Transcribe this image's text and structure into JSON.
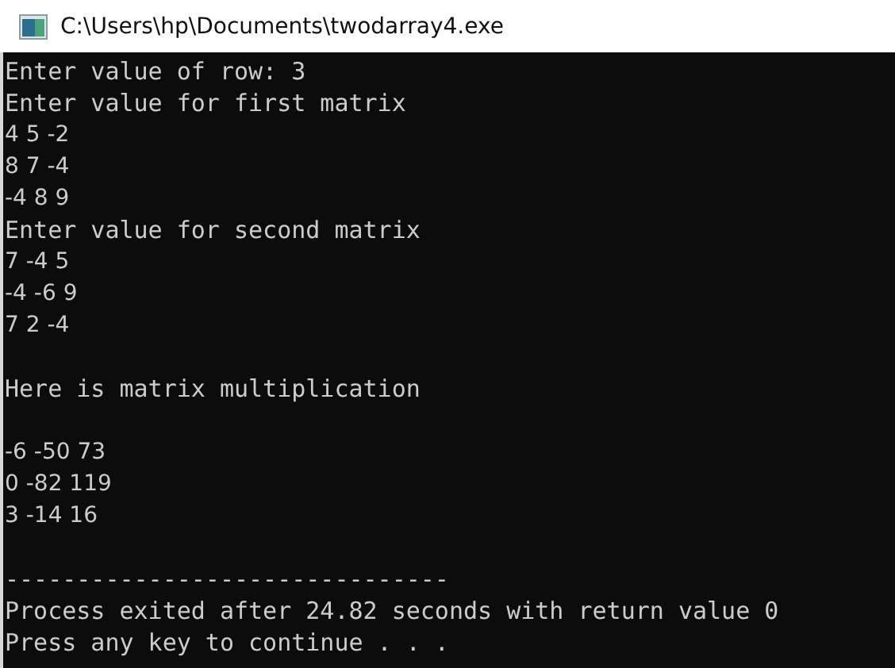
{
  "window": {
    "title": "C:\\Users\\hp\\Documents\\twodarray4.exe"
  },
  "console": {
    "lines": [
      {
        "kind": "mono",
        "text": "Enter value of row: 3"
      },
      {
        "kind": "mono",
        "text": "Enter value for first matrix"
      },
      {
        "kind": "sans",
        "text": "4 5 -2"
      },
      {
        "kind": "sans",
        "text": "8 7 -4"
      },
      {
        "kind": "sans",
        "text": "-4 8 9"
      },
      {
        "kind": "mono",
        "text": "Enter value for second matrix"
      },
      {
        "kind": "sans",
        "text": "7 -4 5"
      },
      {
        "kind": "sans",
        "text": "-4 -6 9"
      },
      {
        "kind": "sans",
        "text": "7 2 -4"
      },
      {
        "kind": "blank"
      },
      {
        "kind": "mono",
        "text": "Here is matrix multiplication"
      },
      {
        "kind": "blank"
      },
      {
        "kind": "sans",
        "text": "-6 -50 73"
      },
      {
        "kind": "sans",
        "text": "0 -82 119"
      },
      {
        "kind": "sans",
        "text": "3 -14 16"
      },
      {
        "kind": "blank"
      },
      {
        "kind": "mono",
        "text": "-------------------------------"
      },
      {
        "kind": "mono",
        "text": "Process exited after 24.82 seconds with return value 0"
      },
      {
        "kind": "mono",
        "text": "Press any key to continue . . ."
      }
    ]
  }
}
